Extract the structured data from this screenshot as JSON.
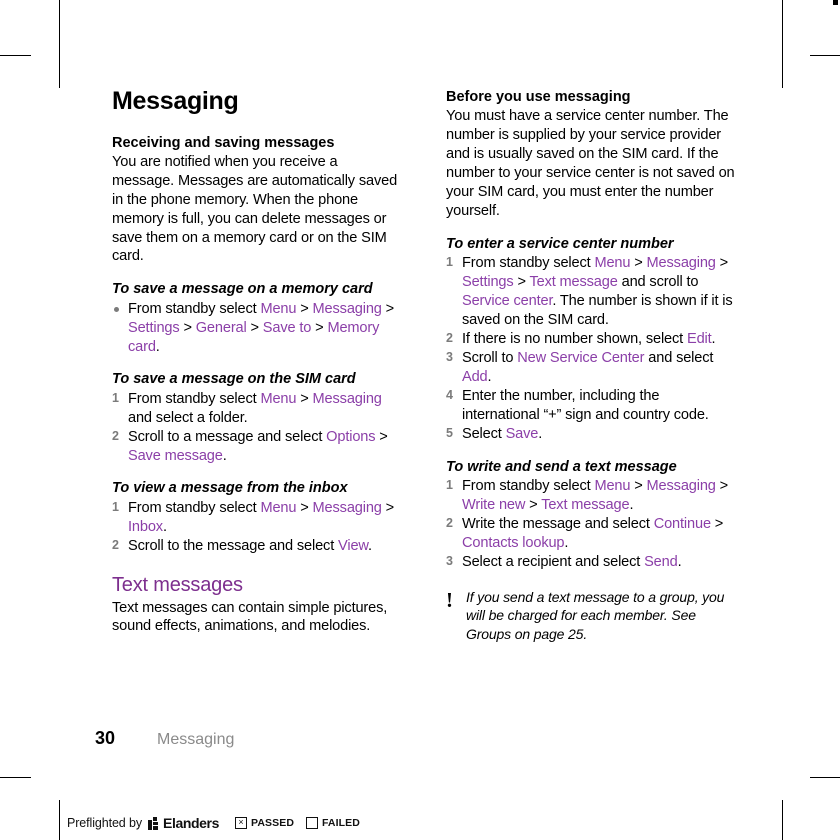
{
  "document": {
    "chapter_title": "Messaging",
    "page_number": "30",
    "footer_chapter": "Messaging",
    "accent_color": "#8b3fa8",
    "heading_color": "#7d2f8e"
  },
  "left_column": {
    "section1": {
      "heading": "Receiving and saving messages",
      "body": "You are notified when you receive a message. Messages are automatically saved in the phone memory. When the phone memory is full, you can delete messages or save them on a memory card or on the SIM card."
    },
    "proc_memory_card": {
      "heading": "To save a message on a memory card",
      "items": [
        {
          "marker": "bullet",
          "parts": [
            {
              "t": "From standby select ",
              "ui": false
            },
            {
              "t": "Menu",
              "ui": true
            },
            {
              "t": " > ",
              "ui": false
            },
            {
              "t": "Messaging",
              "ui": true
            },
            {
              "t": " > ",
              "ui": false
            },
            {
              "t": "Settings",
              "ui": true
            },
            {
              "t": " > ",
              "ui": false
            },
            {
              "t": "General",
              "ui": true
            },
            {
              "t": " > ",
              "ui": false
            },
            {
              "t": "Save to",
              "ui": true
            },
            {
              "t": " > ",
              "ui": false
            },
            {
              "t": "Memory card",
              "ui": true
            },
            {
              "t": ".",
              "ui": false
            }
          ]
        }
      ]
    },
    "proc_sim_card": {
      "heading": "To save a message on the SIM card",
      "items": [
        {
          "num": "1",
          "parts": [
            {
              "t": "From standby select ",
              "ui": false
            },
            {
              "t": "Menu",
              "ui": true
            },
            {
              "t": " > ",
              "ui": false
            },
            {
              "t": "Messaging",
              "ui": true
            },
            {
              "t": " and select a folder.",
              "ui": false
            }
          ]
        },
        {
          "num": "2",
          "parts": [
            {
              "t": "Scroll to a message and select ",
              "ui": false
            },
            {
              "t": "Options",
              "ui": true
            },
            {
              "t": " > ",
              "ui": false
            },
            {
              "t": "Save message",
              "ui": true
            },
            {
              "t": ".",
              "ui": false
            }
          ]
        }
      ]
    },
    "proc_view_inbox": {
      "heading": "To view a message from the inbox",
      "items": [
        {
          "num": "1",
          "parts": [
            {
              "t": "From standby select ",
              "ui": false
            },
            {
              "t": "Menu",
              "ui": true
            },
            {
              "t": " > ",
              "ui": false
            },
            {
              "t": "Messaging",
              "ui": true
            },
            {
              "t": " > ",
              "ui": false
            },
            {
              "t": "Inbox",
              "ui": true
            },
            {
              "t": ".",
              "ui": false
            }
          ]
        },
        {
          "num": "2",
          "parts": [
            {
              "t": "Scroll to the message and select ",
              "ui": false
            },
            {
              "t": "View",
              "ui": true
            },
            {
              "t": ".",
              "ui": false
            }
          ]
        }
      ]
    },
    "section_text_messages": {
      "heading": "Text messages",
      "body": "Text messages can contain simple pictures, sound effects, animations, and melodies."
    }
  },
  "right_column": {
    "section_before": {
      "heading": "Before you use messaging",
      "body": "You must have a service center number. The number is supplied by your service provider and is usually saved on the SIM card. If the number to your service center is not saved on your SIM card, you must enter the number yourself."
    },
    "proc_service_center": {
      "heading": "To enter a service center number",
      "items": [
        {
          "num": "1",
          "parts": [
            {
              "t": "From standby select ",
              "ui": false
            },
            {
              "t": "Menu",
              "ui": true
            },
            {
              "t": " > ",
              "ui": false
            },
            {
              "t": "Messaging",
              "ui": true
            },
            {
              "t": " > ",
              "ui": false
            },
            {
              "t": "Settings",
              "ui": true
            },
            {
              "t": " > ",
              "ui": false
            },
            {
              "t": "Text message",
              "ui": true
            },
            {
              "t": " and scroll to ",
              "ui": false
            },
            {
              "t": "Service center",
              "ui": true
            },
            {
              "t": ". The number is shown if it is saved on the SIM card.",
              "ui": false
            }
          ]
        },
        {
          "num": "2",
          "parts": [
            {
              "t": "If there is no number shown, select ",
              "ui": false
            },
            {
              "t": "Edit",
              "ui": true
            },
            {
              "t": ".",
              "ui": false
            }
          ]
        },
        {
          "num": "3",
          "parts": [
            {
              "t": "Scroll to ",
              "ui": false
            },
            {
              "t": "New Service Center",
              "ui": true
            },
            {
              "t": " and select ",
              "ui": false
            },
            {
              "t": "Add",
              "ui": true
            },
            {
              "t": ".",
              "ui": false
            }
          ]
        },
        {
          "num": "4",
          "parts": [
            {
              "t": "Enter the number, including the international “+” sign and country code.",
              "ui": false
            }
          ]
        },
        {
          "num": "5",
          "parts": [
            {
              "t": "Select ",
              "ui": false
            },
            {
              "t": "Save",
              "ui": true
            },
            {
              "t": ".",
              "ui": false
            }
          ]
        }
      ]
    },
    "proc_write_send": {
      "heading": "To write and send a text message",
      "items": [
        {
          "num": "1",
          "parts": [
            {
              "t": "From standby select ",
              "ui": false
            },
            {
              "t": "Menu",
              "ui": true
            },
            {
              "t": " > ",
              "ui": false
            },
            {
              "t": "Messaging",
              "ui": true
            },
            {
              "t": " > ",
              "ui": false
            },
            {
              "t": "Write new",
              "ui": true
            },
            {
              "t": " > ",
              "ui": false
            },
            {
              "t": "Text message",
              "ui": true
            },
            {
              "t": ".",
              "ui": false
            }
          ]
        },
        {
          "num": "2",
          "parts": [
            {
              "t": "Write the message and select ",
              "ui": false
            },
            {
              "t": "Continue",
              "ui": true
            },
            {
              "t": " > ",
              "ui": false
            },
            {
              "t": "Contacts lookup",
              "ui": true
            },
            {
              "t": ".",
              "ui": false
            }
          ]
        },
        {
          "num": "3",
          "parts": [
            {
              "t": "Select a recipient and select ",
              "ui": false
            },
            {
              "t": "Send",
              "ui": true
            },
            {
              "t": ".",
              "ui": false
            }
          ]
        }
      ]
    },
    "note": {
      "icon": "exclamation-icon",
      "text": "If you send a text message to a group, you will be charged for each member. See Groups on page 25."
    }
  },
  "preflight_bar": {
    "prefix_text": "Preflighted by",
    "brand": "Elanders",
    "passed_label": "PASSED",
    "passed_mark": "×",
    "passed_checked": true,
    "failed_label": "FAILED",
    "failed_mark": "",
    "failed_checked": false
  }
}
